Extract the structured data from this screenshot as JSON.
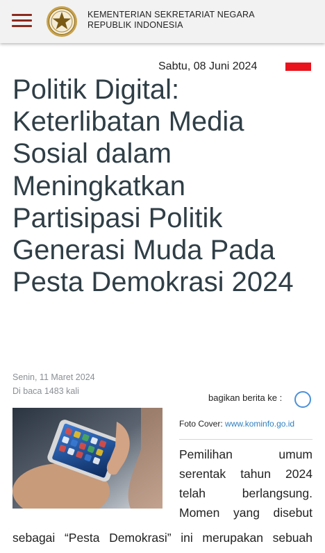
{
  "header": {
    "org_line1": "KEMENTERIAN SEKRETARIAT NEGARA",
    "org_line2": "REPUBLIK INDONESIA"
  },
  "date": "Sabtu, 08 Juni 2024",
  "article": {
    "title": "Politik Digital: Keterlibatan Media Sosial dalam Meningkatkan Partisipasi Politik Generasi Muda Pada Pesta Demokrasi 2024",
    "published": "Senin, 11 Maret 2024",
    "views": "Di baca 1483 kali",
    "share_label": "bagikan berita ke :",
    "cover_label": "Foto Cover:",
    "cover_link": "www.kominfo.go.id",
    "body_lines": [
      "Pemilihan umum",
      "serentak tahun 2024",
      "telah berlangsung.",
      "Momen yang disebut"
    ],
    "body_wide_line": "sebagai “Pesta Demokrasi” ini merupakan sebuah"
  },
  "colors": {
    "title": "#2f3e46",
    "menu_icon": "#8b2a1e",
    "flag": "#e8131d",
    "link": "#2d7fc1"
  },
  "icons": [
    "hamburger-menu-icon",
    "garuda-emblem-logo",
    "share-icon"
  ]
}
